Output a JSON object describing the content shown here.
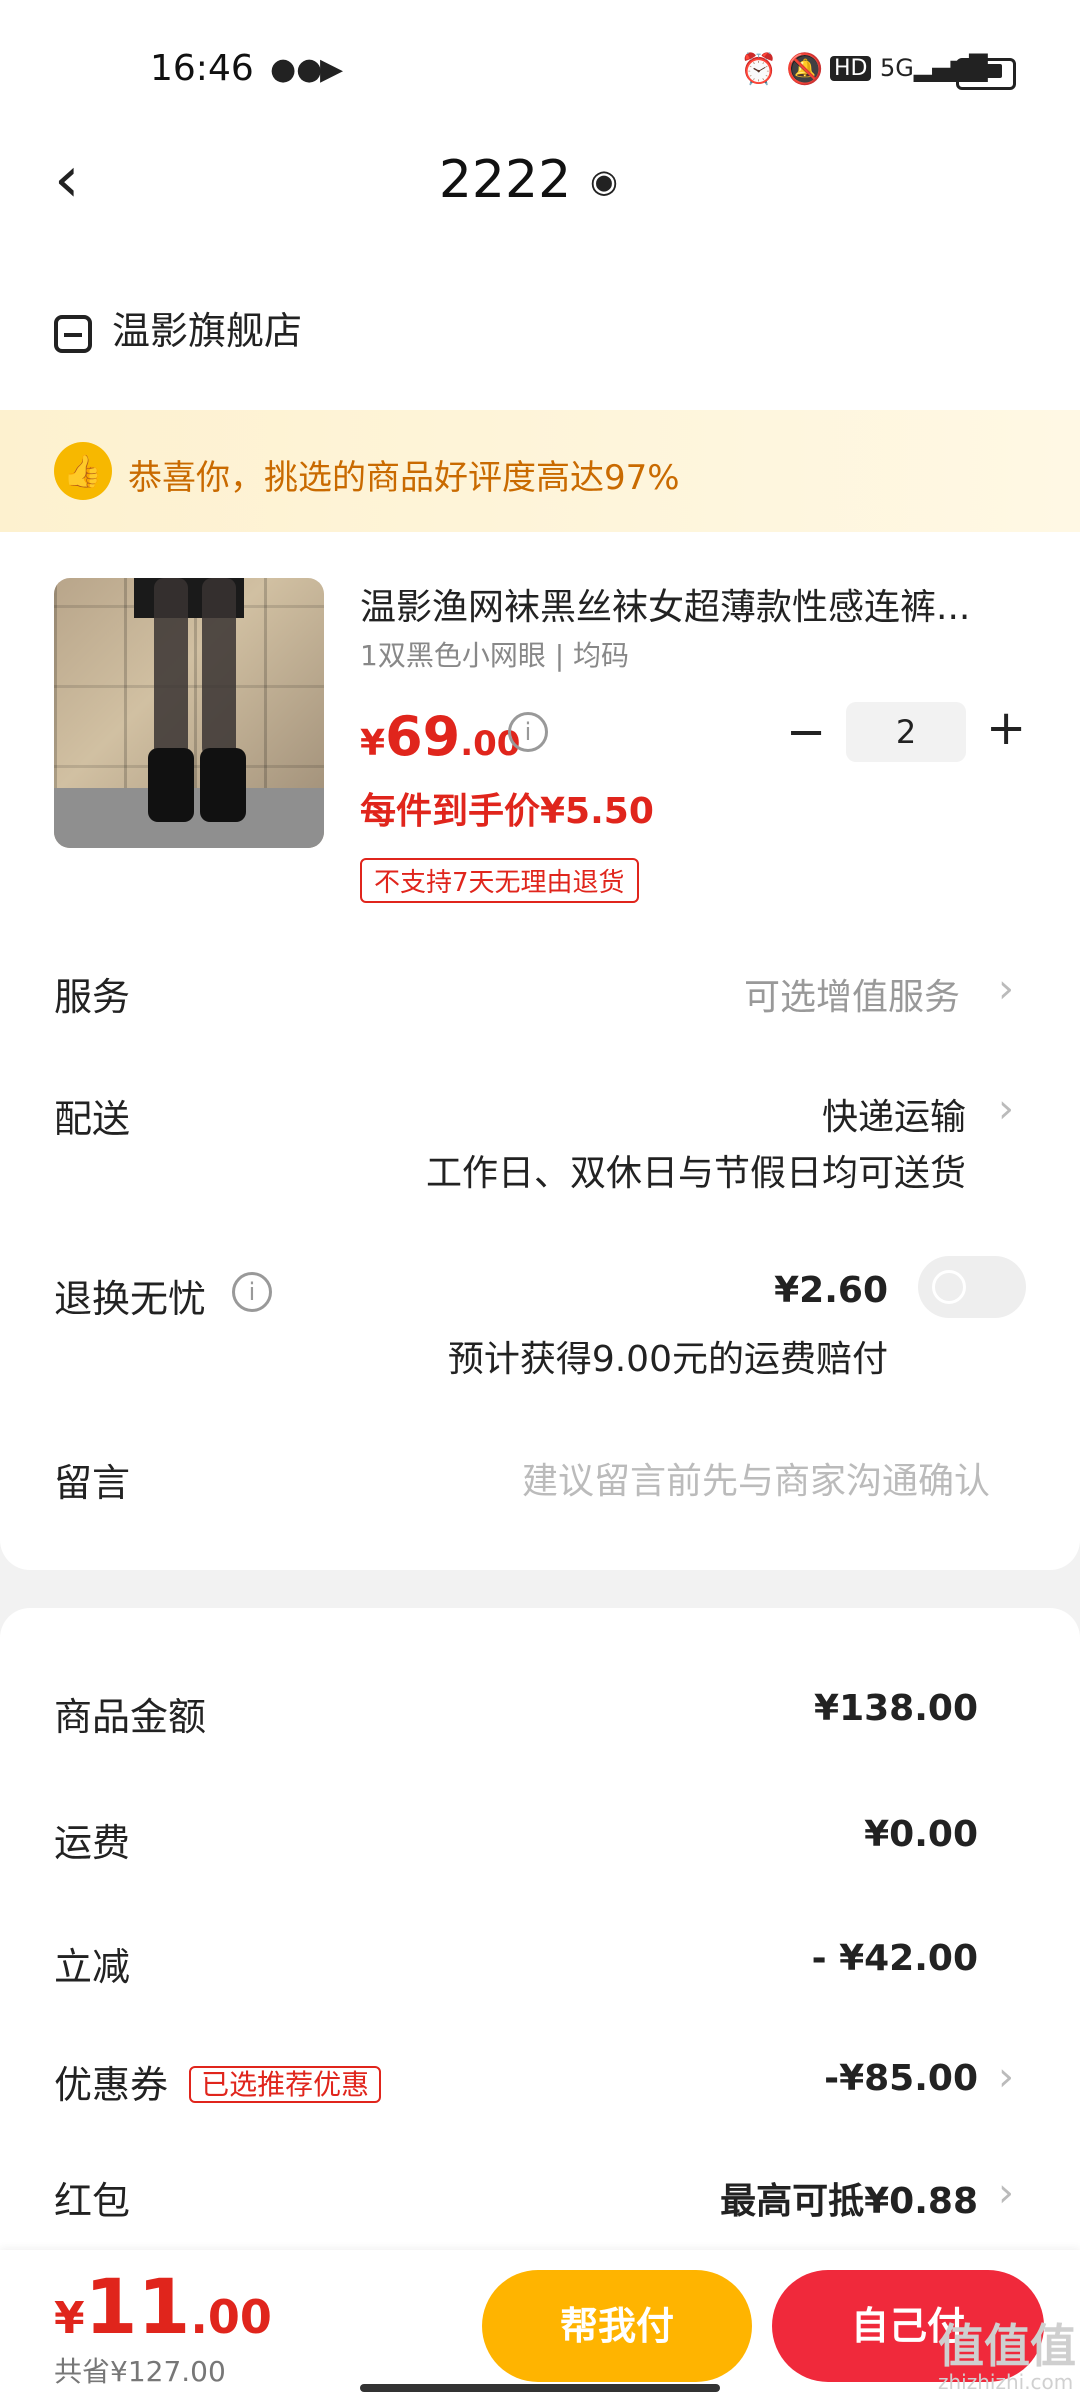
{
  "status_bar": {
    "time": "16:46",
    "icons": [
      "wechat-icon",
      "app-icon",
      "alarm-icon",
      "mute-icon",
      "hd-icon",
      "signal-5g-icon",
      "battery-icon"
    ]
  },
  "header": {
    "title": "2222",
    "back_icon": "back-icon",
    "location_icon": "location-pin-icon"
  },
  "store": {
    "name": "温影旗舰店"
  },
  "banner": {
    "text": "恭喜你，挑选的商品好评度高达97%"
  },
  "product": {
    "title": "温影渔网袜黑丝袜女超薄款性感连裤...",
    "spec": "1双黑色小网眼 | 均码",
    "price_currency": "¥",
    "price_int": "69",
    "price_dec": ".00",
    "each_price": "每件到手价¥5.50",
    "return_tag": "不支持7天无理由退货",
    "quantity": "2",
    "minus": "−",
    "plus": "+"
  },
  "rows": {
    "service_label": "服务",
    "service_value": "可选增值服务",
    "delivery_label": "配送",
    "delivery_value": "快递运输",
    "delivery_note": "工作日、双休日与节假日均可送货",
    "return_label": "退换无忧",
    "return_price": "¥2.60",
    "return_note": "预计获得9.00元的运费赔付",
    "message_label": "留言",
    "message_placeholder": "建议留言前先与商家沟通确认"
  },
  "summary": {
    "goods_label": "商品金额",
    "goods_value": "¥138.00",
    "shipping_label": "运费",
    "shipping_value": "¥0.00",
    "discount_label": "立减",
    "discount_value": "- ¥42.00",
    "coupon_label": "优惠券",
    "coupon_tag": "已选推荐优惠",
    "coupon_value": "-¥85.00",
    "redpacket_label": "红包",
    "redpacket_value": "最高可抵¥0.88"
  },
  "bottom": {
    "total_currency": "¥",
    "total_int": "11",
    "total_dec": ".00",
    "saved": "共省¥127.00",
    "help_pay": "帮我付",
    "self_pay": "自己付",
    "watermark": "值值值",
    "watermark_sub": "zhizhizhi.com"
  },
  "colors": {
    "accent_red": "#e0251c",
    "pay_red": "#f0293b",
    "help_yellow": "#ffb400",
    "banner_orange": "#c96a00"
  }
}
